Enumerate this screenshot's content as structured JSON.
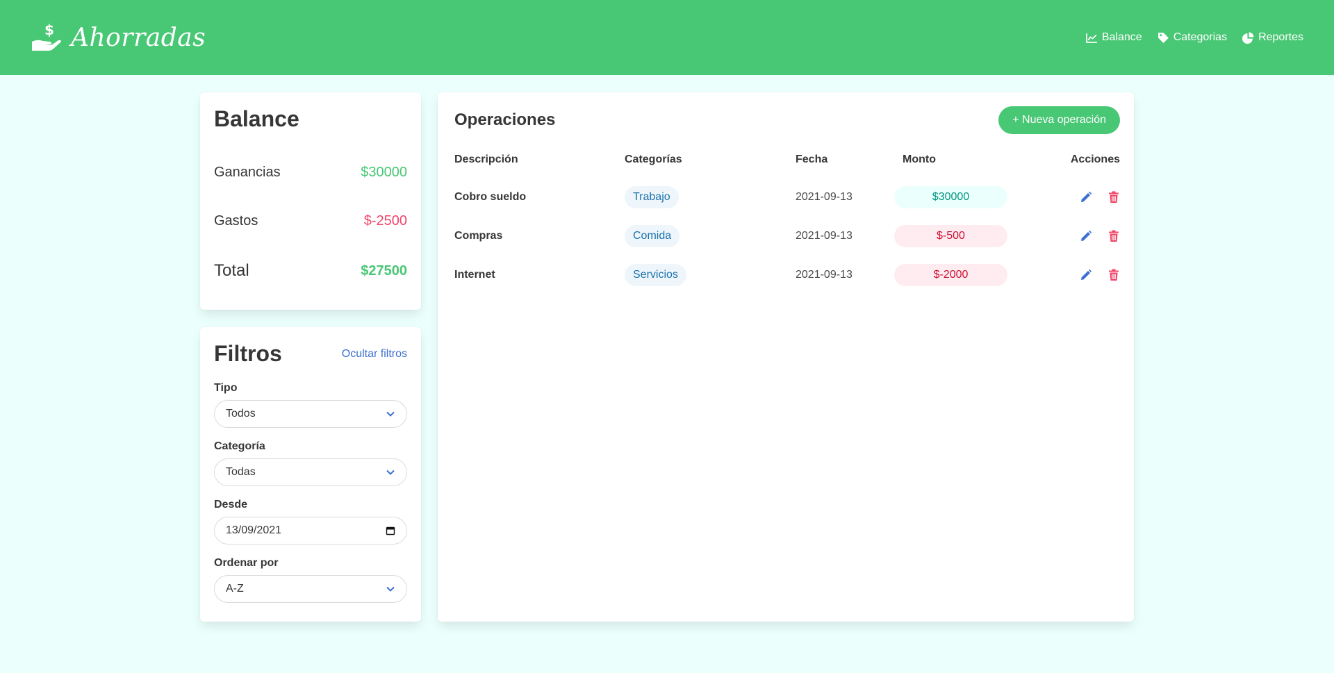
{
  "navbar": {
    "brand": "Ahorradas",
    "items": [
      {
        "label": "Balance",
        "icon": "chart-line-icon"
      },
      {
        "label": "Categorias",
        "icon": "tag-icon"
      },
      {
        "label": "Reportes",
        "icon": "pie-chart-icon"
      }
    ]
  },
  "balance": {
    "title": "Balance",
    "ganancias_label": "Ganancias",
    "ganancias_value": "$30000",
    "gastos_label": "Gastos",
    "gastos_value": "$-2500",
    "total_label": "Total",
    "total_value": "$27500"
  },
  "filters": {
    "title": "Filtros",
    "hide_link": "Ocultar filtros",
    "tipo_label": "Tipo",
    "tipo_value": "Todos",
    "categoria_label": "Categoría",
    "categoria_value": "Todas",
    "desde_label": "Desde",
    "desde_value": "13/09/2021",
    "ordenar_label": "Ordenar por",
    "ordenar_value": "A-Z"
  },
  "operations": {
    "title": "Operaciones",
    "new_button": "+ Nueva operación",
    "headers": {
      "descripcion": "Descripción",
      "categorias": "Categorías",
      "fecha": "Fecha",
      "monto": "Monto",
      "acciones": "Acciones"
    },
    "rows": [
      {
        "descripcion": "Cobro sueldo",
        "categoria": "Trabajo",
        "fecha": "2021-09-13",
        "monto": "$30000",
        "tipo": "ganancia"
      },
      {
        "descripcion": "Compras",
        "categoria": "Comida",
        "fecha": "2021-09-13",
        "monto": "$-500",
        "tipo": "gasto"
      },
      {
        "descripcion": "Internet",
        "categoria": "Servicios",
        "fecha": "2021-09-13",
        "monto": "$-2000",
        "tipo": "gasto"
      }
    ]
  },
  "colors": {
    "primary": "#48c774",
    "danger": "#f14668",
    "link": "#3e6fd1",
    "background": "#ebfffc"
  }
}
